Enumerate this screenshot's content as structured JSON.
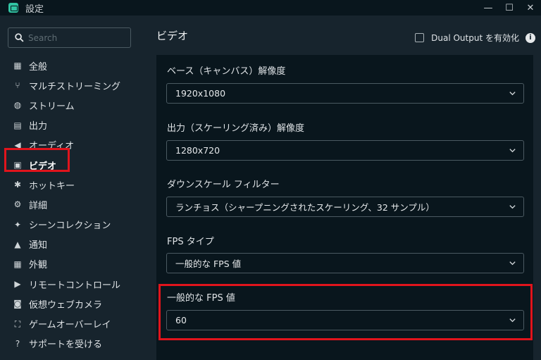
{
  "window": {
    "title": "設定",
    "minimize": "—",
    "maximize": "☐",
    "close": "✕"
  },
  "search": {
    "placeholder": "Search"
  },
  "sidebar": {
    "items": [
      {
        "label": "全般",
        "icon": "grid-icon",
        "glyph": "▦"
      },
      {
        "label": "マルチストリーミング",
        "icon": "share-icon",
        "glyph": "⑂"
      },
      {
        "label": "ストリーム",
        "icon": "globe-icon",
        "glyph": "◍"
      },
      {
        "label": "出力",
        "icon": "output-icon",
        "glyph": "▤"
      },
      {
        "label": "オーディオ",
        "icon": "speaker-icon",
        "glyph": "◀"
      },
      {
        "label": "ビデオ",
        "icon": "film-icon",
        "glyph": "▣"
      },
      {
        "label": "ホットキー",
        "icon": "gear-icon",
        "glyph": "✱"
      },
      {
        "label": "詳細",
        "icon": "gears-icon",
        "glyph": "⚙"
      },
      {
        "label": "シーンコレクション",
        "icon": "wand-icon",
        "glyph": "✦"
      },
      {
        "label": "通知",
        "icon": "bell-icon",
        "glyph": "▲"
      },
      {
        "label": "外観",
        "icon": "palette-icon",
        "glyph": "▦"
      },
      {
        "label": "リモートコントロール",
        "icon": "play-circle-icon",
        "glyph": "▶"
      },
      {
        "label": "仮想ウェブカメラ",
        "icon": "camera-icon",
        "glyph": "◙"
      },
      {
        "label": "ゲームオーバーレイ",
        "icon": "expand-icon",
        "glyph": "⛶"
      },
      {
        "label": "サポートを受ける",
        "icon": "help-icon",
        "glyph": "?"
      }
    ],
    "active_index": 5
  },
  "main": {
    "title": "ビデオ",
    "dual_output_label": "Dual Output を有効化",
    "dual_output_checked": false,
    "info": "i",
    "fields": [
      {
        "label": "ベース（キャンバス）解像度",
        "value": "1920x1080"
      },
      {
        "label": "出力（スケーリング済み）解像度",
        "value": "1280x720"
      },
      {
        "label": "ダウンスケール フィルター",
        "value": "ランチョス（シャープニングされたスケーリング、32 サンプル）"
      },
      {
        "label": "FPS タイプ",
        "value": "一般的な FPS 値"
      },
      {
        "label": "一般的な FPS 値",
        "value": "60"
      }
    ]
  },
  "colors": {
    "background": "#17242d",
    "panel": "#09161d",
    "highlight": "#e1141c",
    "accent": "#31c3a2"
  }
}
